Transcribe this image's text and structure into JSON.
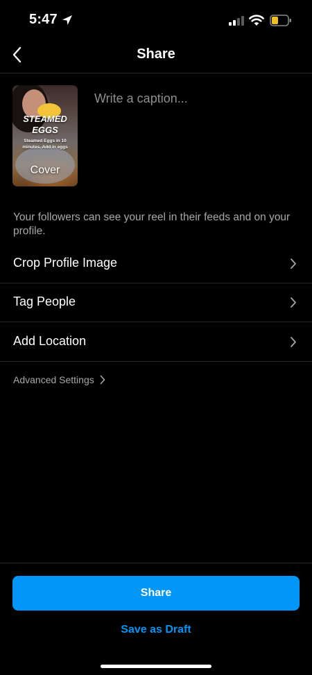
{
  "status_bar": {
    "time": "5:47",
    "battery_color": "#f2c01e"
  },
  "nav": {
    "title": "Share",
    "back_icon": "chevron-left-icon"
  },
  "cover": {
    "title": "STEAMED EGGS",
    "subtitle": "Steamed Eggs in 10 minutes. Add in eggs",
    "label": "Cover"
  },
  "caption": {
    "placeholder": "Write a caption..."
  },
  "info_text": "Your followers can see your reel in their feeds and on your profile.",
  "rows": [
    {
      "label": "Crop Profile Image"
    },
    {
      "label": "Tag People"
    },
    {
      "label": "Add Location"
    }
  ],
  "advanced_settings": {
    "label": "Advanced Settings"
  },
  "actions": {
    "share_label": "Share",
    "draft_label": "Save as Draft",
    "accent_color": "#0095f6"
  }
}
